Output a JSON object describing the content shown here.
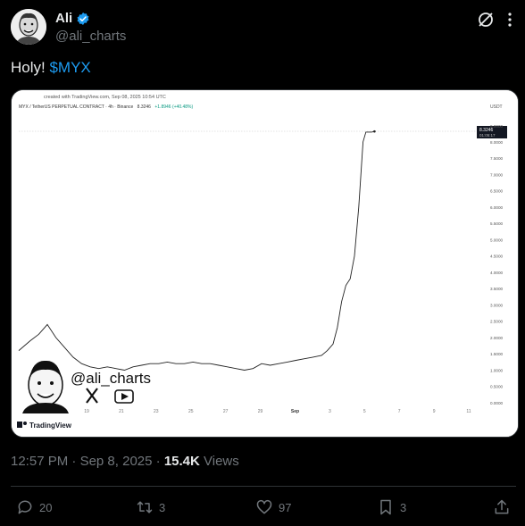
{
  "author": {
    "display_name": "Ali",
    "handle": "@ali_charts"
  },
  "tweet": {
    "text_prefix": "Holy!",
    "cashtag": "$MYX"
  },
  "media": {
    "created_with": "created with TradingView.com, Sep 08, 2025 10:54 UTC",
    "symbol_line": "MYX / TetherUS PERPETUAL CONTRACT · 4h · Binance",
    "price": "8.3246",
    "change": "+1.8946 (+40.48%)",
    "currency": "USDT",
    "last_price_label": "8.3246",
    "countdown_label": "01:05:17",
    "watermark_handle": "@ali_charts",
    "brand": "TradingView",
    "accent": "#089981",
    "chart_data": {
      "type": "line",
      "x_tick_labels": [
        "19",
        "21",
        "23",
        "25",
        "27",
        "29",
        "Sep",
        "3",
        "5",
        "7",
        "9",
        "11"
      ],
      "y_tick_labels": [
        "0.0000",
        "0.5000",
        "1.0000",
        "1.5000",
        "2.0000",
        "2.5000",
        "3.0000",
        "3.5000",
        "4.0000",
        "4.5000",
        "5.0000",
        "5.5000",
        "6.0000",
        "6.5000",
        "7.0000",
        "7.5000",
        "8.0000",
        "9.0000"
      ],
      "ylim": [
        0,
        9
      ],
      "x_range": [
        17,
        49
      ],
      "series": [
        {
          "x": [
            17,
            17.8,
            18.4,
            19.0,
            19.6,
            20.2,
            20.8,
            21.4,
            22.0,
            22.6,
            23.2,
            23.8,
            24.4,
            25.0,
            25.6,
            26.2,
            26.8,
            27.4,
            28.0,
            28.6,
            29.2,
            29.8,
            30.4,
            31.0,
            31.6,
            32.2,
            32.8,
            33.4,
            34.0,
            34.6,
            35.2,
            35.8,
            36.4,
            37.0,
            37.6,
            38.2,
            38.6,
            39.0,
            39.3,
            39.6,
            39.9,
            40.2,
            40.5,
            40.8,
            41.1,
            41.3,
            41.5,
            41.7,
            41.9
          ],
          "y": [
            1.6,
            1.9,
            2.1,
            2.4,
            2.0,
            1.7,
            1.4,
            1.2,
            1.1,
            1.05,
            1.1,
            1.05,
            1.0,
            1.1,
            1.15,
            1.2,
            1.2,
            1.25,
            1.2,
            1.2,
            1.25,
            1.2,
            1.2,
            1.15,
            1.1,
            1.05,
            1.0,
            1.05,
            1.2,
            1.15,
            1.2,
            1.25,
            1.3,
            1.35,
            1.4,
            1.45,
            1.6,
            1.8,
            2.3,
            3.1,
            3.6,
            3.8,
            4.5,
            6.0,
            8.0,
            8.3,
            8.3,
            8.3,
            8.32
          ]
        }
      ],
      "grid": false
    }
  },
  "footer": {
    "time": "12:57 PM",
    "separator": "·",
    "date": "Sep 8, 2025",
    "views_count": "15.4K",
    "views_label": "Views"
  },
  "actions": {
    "replies": "20",
    "reposts": "3",
    "likes": "97",
    "bookmarks": "3"
  }
}
